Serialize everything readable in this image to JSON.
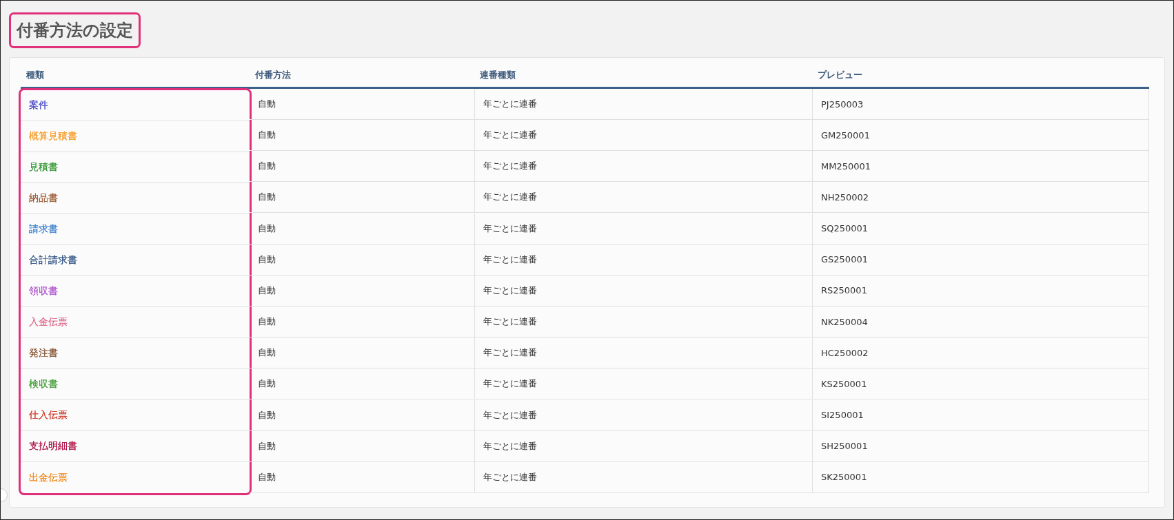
{
  "title": {
    "text": "付番方法の設定",
    "highlighted": true
  },
  "columns": [
    {
      "label": "種類"
    },
    {
      "label": "付番方法"
    },
    {
      "label": "連番種類"
    },
    {
      "label": "プレビュー"
    }
  ],
  "type_column_highlighted": true,
  "rows": [
    {
      "type": "案件",
      "color": "#4f4fc9",
      "method": "自動",
      "sequence": "年ごとに連番",
      "preview": "PJ250003"
    },
    {
      "type": "概算見積書",
      "color": "#f5a030",
      "method": "自動",
      "sequence": "年ごとに連番",
      "preview": "GM250001"
    },
    {
      "type": "見積書",
      "color": "#3a9a3a",
      "method": "自動",
      "sequence": "年ごとに連番",
      "preview": "MM250001"
    },
    {
      "type": "納品書",
      "color": "#a0603a",
      "method": "自動",
      "sequence": "年ごとに連番",
      "preview": "NH250002"
    },
    {
      "type": "請求書",
      "color": "#4a8ad0",
      "method": "自動",
      "sequence": "年ごとに連番",
      "preview": "SQ250001"
    },
    {
      "type": "合計請求書",
      "color": "#3a5a8a",
      "method": "自動",
      "sequence": "年ごとに連番",
      "preview": "GS250001"
    },
    {
      "type": "領収書",
      "color": "#b05ad0",
      "method": "自動",
      "sequence": "年ごとに連番",
      "preview": "RS250001"
    },
    {
      "type": "入金伝票",
      "color": "#e07090",
      "method": "自動",
      "sequence": "年ごとに連番",
      "preview": "NK250004"
    },
    {
      "type": "発注書",
      "color": "#8a5a3a",
      "method": "自動",
      "sequence": "年ごとに連番",
      "preview": "HC250002"
    },
    {
      "type": "検収書",
      "color": "#4aa040",
      "method": "自動",
      "sequence": "年ごとに連番",
      "preview": "KS250001"
    },
    {
      "type": "仕入伝票",
      "color": "#d04030",
      "method": "自動",
      "sequence": "年ごとに連番",
      "preview": "SI250001"
    },
    {
      "type": "支払明細書",
      "color": "#b0184a",
      "method": "自動",
      "sequence": "年ごとに連番",
      "preview": "SH250001"
    },
    {
      "type": "出金伝票",
      "color": "#f08a20",
      "method": "自動",
      "sequence": "年ごとに連番",
      "preview": "SK250001"
    }
  ]
}
